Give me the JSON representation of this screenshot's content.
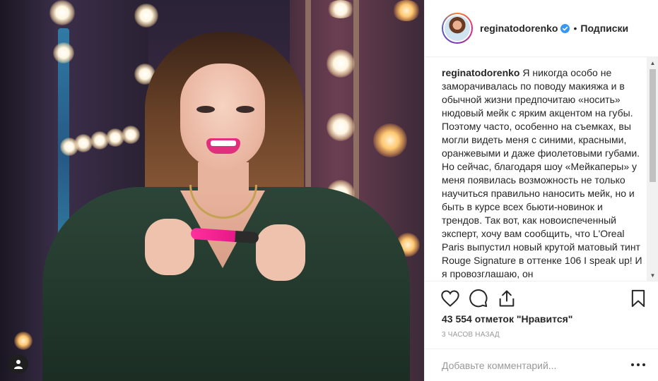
{
  "post": {
    "username": "reginatodorenko",
    "separator": "•",
    "follow_label": "Подписки",
    "caption_text": "Я никогда особо не заморачивалась по поводу макияжа и в обычной жизни предпочитаю «носить» нюдовый мейк с ярким акцентом на губы. Поэтому часто, особенно на съемках, вы могли видеть меня с синими, красными, оранжевыми и даже фиолетовыми губами. Но сейчас, благодаря шоу «Мейкаперы» у меня появилась возможность не только научиться правильно наносить мейк, но и быть в курсе всех бьюти-новинок и трендов. Так вот, как новоиспеченный эксперт, хочу вам сообщить, что L'Oreal Paris выпустил новый крутой матовый тинт Rouge Signature в оттенке 106 I speak up! И я провозглашаю, он",
    "likes": "43 554 отметок \"Нравится\"",
    "timestamp": "3 часов назад"
  },
  "comment": {
    "placeholder": "Добавьте комментарий..."
  },
  "icons": {
    "verified": "verified-badge-icon",
    "like": "heart-icon",
    "comment": "comment-icon",
    "share": "share-icon",
    "save": "bookmark-icon",
    "more": "more-options-icon",
    "profile": "user-icon"
  },
  "colors": {
    "verified_blue": "#3897f0",
    "text": "#262626",
    "muted": "#999999"
  }
}
